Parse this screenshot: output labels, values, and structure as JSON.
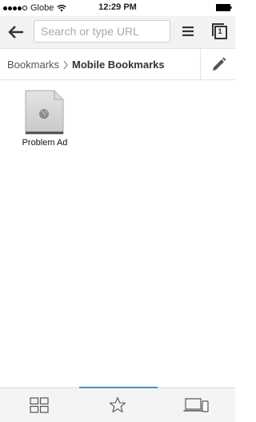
{
  "status_bar": {
    "carrier": "Globe",
    "time": "12:29 PM",
    "signal_bars_filled": 4,
    "signal_bars_total": 5
  },
  "toolbar": {
    "omnibox_placeholder": "Search or type URL",
    "omnibox_value": "",
    "tab_count": "1"
  },
  "breadcrumb": {
    "root": "Bookmarks",
    "current": "Mobile Bookmarks"
  },
  "bookmarks": [
    {
      "label": "Problem Ad",
      "icon": "file-globe-icon"
    }
  ],
  "bottom_nav": {
    "active": "bookmarks",
    "items": [
      {
        "id": "most-visited",
        "icon": "grid-icon"
      },
      {
        "id": "bookmarks",
        "icon": "star-icon"
      },
      {
        "id": "other-devices",
        "icon": "devices-icon"
      }
    ]
  },
  "colors": {
    "active_indicator": "#4a90d9",
    "toolbar_bg": "#f2f2f2",
    "placeholder": "#aaaaaa"
  }
}
